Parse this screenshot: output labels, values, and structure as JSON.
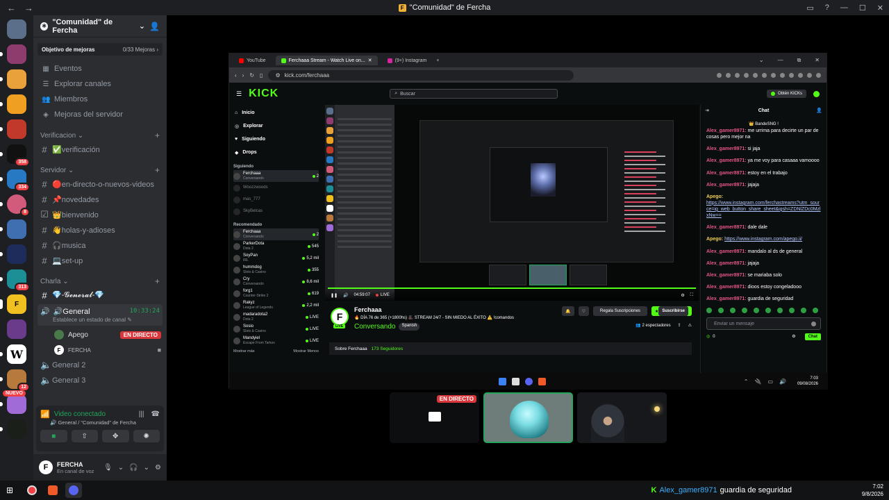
{
  "titlebar": {
    "title": "\"Comunidad\" de Fercha",
    "icon_letter": "F"
  },
  "guild_badges": [
    "358",
    "334",
    "8",
    "313",
    "12"
  ],
  "guild_new": "NUEVO",
  "server": {
    "name": "\"Comunidad\" de Fercha",
    "boost_label": "Objetivo de mejoras",
    "boost_count": "0/33 Mejoras",
    "menu": [
      "Eventos",
      "Explorar canales",
      "Miembros",
      "Mejoras del servidor"
    ],
    "categories": [
      "Verificacion",
      "Servidor",
      "Charla"
    ],
    "verif_channels": [
      "✅verificación"
    ],
    "server_channels": [
      "🔴en-directo-o-nuevos-videos",
      "📌novedades",
      "👑bienvenido",
      "👋holas-y-adioses",
      "🎧musica",
      "💻set-up"
    ],
    "charla_text": "💎-𝓖𝓮𝓷𝓮𝓻𝓪𝓵-💎",
    "voice_active": {
      "name": "🔊General",
      "time": "10:33:24",
      "status": "Establece un estado de canal"
    },
    "voice_users": [
      {
        "initial": "",
        "name": "Apego",
        "badge": "EN DIRECTO"
      },
      {
        "initial": "F",
        "name": "FERCHA"
      }
    ],
    "voice_channels": [
      "General 2",
      "General 3"
    ]
  },
  "vc_panel": {
    "status": "Video conectado",
    "path": "General / \"Comunidad\" de Fercha"
  },
  "user": {
    "initial": "F",
    "name": "FERCHA",
    "status": "En canal de voz"
  },
  "browser": {
    "tabs": [
      "YouTube",
      "Ferchaaa Stream - Watch Live on...",
      "(9+) Instagram"
    ],
    "url": "kick.com/ferchaaa"
  },
  "kick": {
    "logo": "KICK",
    "search_placeholder": "Buscar",
    "get_kicks": "Obtén KICKs",
    "nav": [
      "Inicio",
      "Explorar",
      "Siguiendo",
      "Drops"
    ],
    "following_label": "Siguiendo",
    "following": [
      {
        "name": "Ferchaaa",
        "cat": "Conversando",
        "viewers": "2"
      },
      {
        "name": "Woozzwoods",
        "cat": "",
        "viewers": ""
      },
      {
        "name": "mas_777",
        "cat": "",
        "viewers": ""
      },
      {
        "name": "SkyBelcas",
        "cat": "",
        "viewers": ""
      }
    ],
    "recommended_label": "Recomendado",
    "recommended": [
      {
        "name": "Ferchaaa",
        "cat": "Conversando",
        "viewers": "2"
      },
      {
        "name": "ParkerDota",
        "cat": "Dota 2",
        "viewers": "545"
      },
      {
        "name": "SoyPan",
        "cat": "IRL",
        "viewers": "5,2 mil"
      },
      {
        "name": "hummdog",
        "cat": "Slots & Casino",
        "viewers": "355"
      },
      {
        "name": "Cry",
        "cat": "Conversando",
        "viewers": "8,6 mil"
      },
      {
        "name": "forg1",
        "cat": "Counter-Strike 2",
        "viewers": "619"
      },
      {
        "name": "Rakyz",
        "cat": "League of Legends",
        "viewers": "2,2 mil"
      },
      {
        "name": "madaradota2",
        "cat": "Dota 2",
        "viewers": "LIVE"
      },
      {
        "name": "Sosio",
        "cat": "Slots & Casino",
        "viewers": "LIVE"
      },
      {
        "name": "Mandyiel",
        "cat": "Escape From Tarkov",
        "viewers": "LIVE"
      }
    ],
    "show_more": "Mostrar más",
    "show_less": "Mostrar Menos",
    "player_time": "04:59:07",
    "player_live": "LIVE",
    "channel_name": "Ferchaaa",
    "channel_initial": "F",
    "live_tag": "LIVE",
    "stream_title": "🔥 DÍA 76 de 365 (+1800hs) 🎩 STREAM 24/7 - SIN MIEDO AL ÉXITO ⚠️ !comandos",
    "category": "Conversando",
    "language": "Spanish",
    "gift_label": "Regala Suscripciones",
    "subscribe_label": "Suscribirse",
    "spectators": "2 espectadores",
    "about_label": "Sobre Ferchaaa",
    "followers": "173 Seguidores",
    "chat_title": "Chat",
    "pinned": "👑 BandeSNG !",
    "messages": [
      {
        "user": "Alex_gamer8971",
        "text": " me urrima para decirte un par de cosas pero mejor na"
      },
      {
        "user": "Alex_gamer8971",
        "text": " si jaja"
      },
      {
        "user": "Alex_gamer8971",
        "text": " ya me voy para casaaa vamoooo"
      },
      {
        "user": "Alex_gamer8971",
        "text": " estoy en el trabajo"
      },
      {
        "user": "Alex_gamer8971",
        "text": " jajaja"
      },
      {
        "user": "Apego",
        "text": "",
        "link": "https://www.instagram.com/ferchastreams?utm_source=ig_web_button_share_sheet&igsh=ZDNlZDc0MzlxNw=="
      },
      {
        "user": "Alex_gamer8971",
        "text": " dale dale"
      },
      {
        "user": "Apego",
        "text": " ",
        "link": "https://www.instagram.com/apego.ii/"
      },
      {
        "user": "Alex_gamer8971",
        "text": " mandalo al ds de general"
      },
      {
        "user": "Alex_gamer8971",
        "text": " jajaja"
      },
      {
        "user": "Alex_gamer8971",
        "text": " se mariaba solo"
      },
      {
        "user": "Alex_gamer8971",
        "text": " dioos estoy congeladooo"
      },
      {
        "user": "Alex_gamer8971",
        "text": " guardia de seguridad"
      }
    ],
    "chat_placeholder": "Enviar un mensaje",
    "chat_count": "0",
    "chat_send": "Chat"
  },
  "stream_clock": {
    "time": "7:03",
    "date": "09/08/2026"
  },
  "tiles": {
    "live_badge": "EN DIRECTO"
  },
  "taskbar": {
    "toast_user": "Alex_gamer8971",
    "toast_msg": "guardia de seguridad",
    "time": "7:02",
    "date": "9/8/2026"
  }
}
